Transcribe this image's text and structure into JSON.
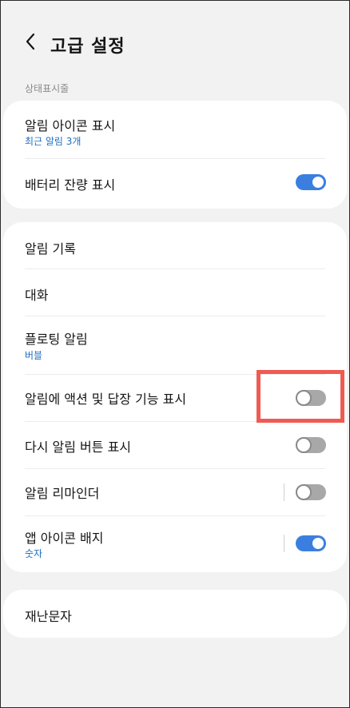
{
  "header": {
    "title": "고급 설정"
  },
  "section_label": "상태표시줄",
  "card1": {
    "items": [
      {
        "label": "알림 아이콘 표시",
        "sub": "최근 알림 3개"
      },
      {
        "label": "배터리 잔량 표시",
        "toggle": true
      }
    ]
  },
  "card2": {
    "items": [
      {
        "label": "알림 기록"
      },
      {
        "label": "대화"
      },
      {
        "label": "플로팅 알림",
        "sub": "버블"
      },
      {
        "label": "알림에 액션 및 답장 기능 표시",
        "toggle": false
      },
      {
        "label": "다시 알림 버튼 표시",
        "toggle": false
      },
      {
        "label": "알림 리마인더",
        "toggle": false
      },
      {
        "label": "앱 아이콘 배지",
        "sub": "숫자",
        "toggle": true
      }
    ]
  },
  "card3": {
    "items": [
      {
        "label": "재난문자"
      }
    ]
  },
  "colors": {
    "accent": "#3a7fe0",
    "sub_text": "#1f6fbf",
    "highlight": "#ef5b52"
  }
}
